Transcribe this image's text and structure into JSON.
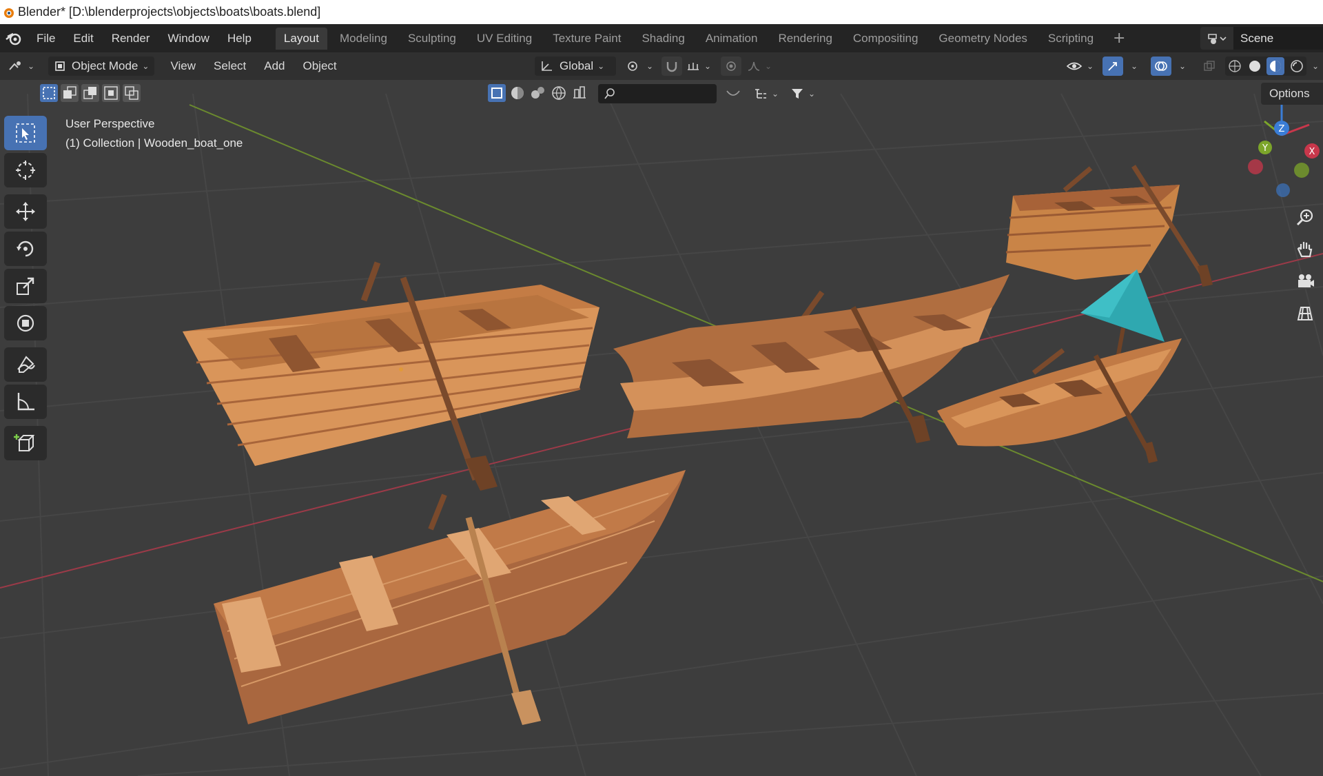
{
  "window": {
    "title": "Blender* [D:\\blenderprojects\\objects\\boats\\boats.blend]"
  },
  "menubar": {
    "items": [
      "File",
      "Edit",
      "Render",
      "Window",
      "Help"
    ]
  },
  "workspaces": {
    "active": "Layout",
    "tabs": [
      "Layout",
      "Modeling",
      "Sculpting",
      "UV Editing",
      "Texture Paint",
      "Shading",
      "Animation",
      "Rendering",
      "Compositing",
      "Geometry Nodes",
      "Scripting"
    ],
    "add_symbol": "+"
  },
  "scene": {
    "name": "Scene"
  },
  "viewport_header": {
    "mode": "Object Mode",
    "menus": [
      "View",
      "Select",
      "Add",
      "Object"
    ],
    "transform_orientation": "Global",
    "options_label": "Options"
  },
  "viewport": {
    "perspective_label": "User Perspective",
    "collection_label": "(1) Collection | Wooden_boat_one",
    "gizmo": {
      "x_label": "X",
      "y_label": "Y",
      "z_label": "Z"
    }
  },
  "colors": {
    "accent": "#4772b3",
    "viewport_bg": "#3d3d3d",
    "x_axis": "#c8374b",
    "y_axis": "#7ca52a",
    "z_axis": "#3a7dd6",
    "wood_light": "#d9955a",
    "wood_dark": "#a0633c",
    "sail": "#2fa8b0"
  },
  "icons": {
    "toolbar": [
      "select-box-icon",
      "cursor-icon",
      "move-icon",
      "rotate-icon",
      "scale-icon",
      "transform-icon",
      "annotate-icon",
      "measure-icon",
      "add-cube-icon"
    ],
    "nav": [
      "zoom-icon",
      "pan-hand-icon",
      "camera-icon",
      "grid-ortho-icon"
    ]
  }
}
